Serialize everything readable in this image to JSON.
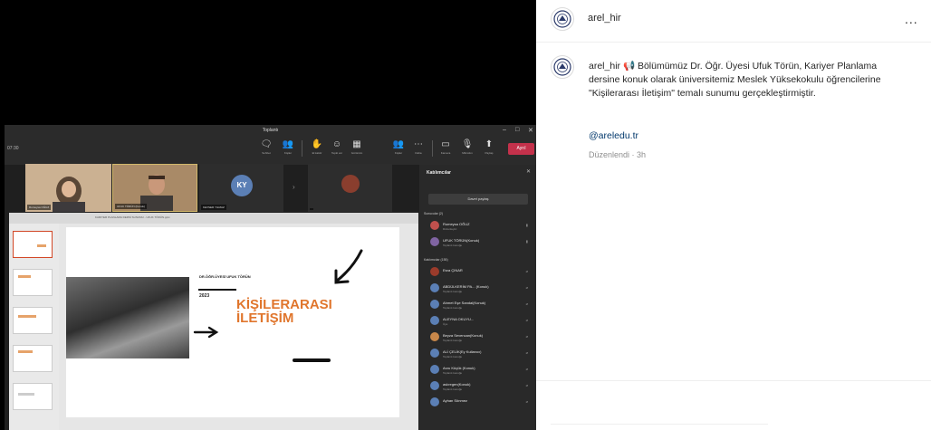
{
  "teams": {
    "window_title": "Toplantı",
    "time": "07:30",
    "window_controls": [
      "–",
      "□",
      "✕"
    ],
    "toolbar": [
      {
        "icon": "chat-icon",
        "glyph": "🗨",
        "label": "Sohbet"
      },
      {
        "icon": "people-icon",
        "glyph": "👥",
        "label": "Kişiler"
      },
      {
        "icon": "raise-hand-icon",
        "glyph": "✋",
        "label": "El kaldır"
      },
      {
        "icon": "react-icon",
        "glyph": "☺",
        "label": "Tepki ver"
      },
      {
        "icon": "view-icon",
        "glyph": "▦",
        "label": "Görünüm"
      },
      {
        "icon": "more-icon",
        "glyph": "⋯",
        "label": "Daha"
      },
      {
        "icon": "camera-icon",
        "glyph": "▭",
        "label": "Kamera"
      },
      {
        "icon": "mic-icon",
        "glyph": "🎙",
        "label": "Mikrofon"
      },
      {
        "icon": "share-icon",
        "glyph": "⬆",
        "label": "Paylaş"
      }
    ],
    "leave_label": "Ayrıl",
    "tiles": [
      {
        "name": "Rumeysa OĞUZ"
      },
      {
        "name": "UFUK TÖRÜN (Konuk)"
      },
      {
        "name": "KEVSER YILMAZ",
        "initials": "KY"
      },
      {
        "name": ""
      }
    ],
    "share": {
      "file_name": "KARIYER PLANLAMA DERSİ SUNUMU - UFUK TÖRÜN.pptx",
      "slide": {
        "author": "DR.ÖĞR.ÜYESİ UFUK TÖRÜN",
        "year": "2023",
        "title_line1": "KİŞİLERARASI",
        "title_line2": "İLETİŞİM"
      }
    },
    "participants_panel": {
      "title": "Katılımcılar",
      "invite_label": "Davet paylaş",
      "sections": [
        {
          "label": "Sunucular (2)",
          "people": [
            {
              "name": "Rumeysa OĞUZ",
              "role": "Düzenleyici",
              "color": "#c0504d"
            },
            {
              "name": "UFUK TÖRÜN(Konuk)",
              "role": "Toplantı konuğu",
              "color": "#8064a2"
            }
          ]
        },
        {
          "label": "Katılımcılar (155)",
          "people": [
            {
              "name": "Esra ÇINAR",
              "role": "",
              "color": "#9b3b2b"
            },
            {
              "name": "ABDÜLKERİM PA... (Konuk)",
              "role": "Toplantı konuğu",
              "color": "#4f81bd"
            },
            {
              "name": "Ahmet Eşe Sandal(Konuk)",
              "role": "Toplantı konuğu",
              "color": "#4f81bd"
            },
            {
              "name": "ALEYNA OKUYU...",
              "role": "Üye",
              "color": "#4f81bd"
            },
            {
              "name": "Beyza Sevencan(Konuk)",
              "role": "Toplantı konuğu",
              "color": "#c9884a"
            },
            {
              "name": "ALİ ÇELİK(Ey Kullanıcı)",
              "role": "Toplantı konuğu",
              "color": "#4f81bd"
            },
            {
              "name": "Arzu Küçük (Konuk)",
              "role": "Toplantı konuğu",
              "color": "#4f81bd"
            },
            {
              "name": "aslıregen(Konuk)",
              "role": "Toplantı konuğu",
              "color": "#4f81bd"
            },
            {
              "name": "Ayhan Sönmez",
              "role": "",
              "color": "#4f81bd"
            }
          ]
        }
      ]
    }
  },
  "post": {
    "username": "arel_hir",
    "more_label": "...",
    "caption_user": "arel_hir",
    "caption_icon": "📢",
    "caption_text": "Bölümümüz Dr. Öğr. Üyesi Ufuk Törün, Kariyer Planlama dersine konuk olarak üniversitemiz Meslek Yüksekokulu öğrencilerine \"Kişilerarası İletişim\" temalı sunumu gerçekleştirmiştir.",
    "hashtag": "@areledu.tr",
    "edited": "Düzenlendi · 3h"
  }
}
